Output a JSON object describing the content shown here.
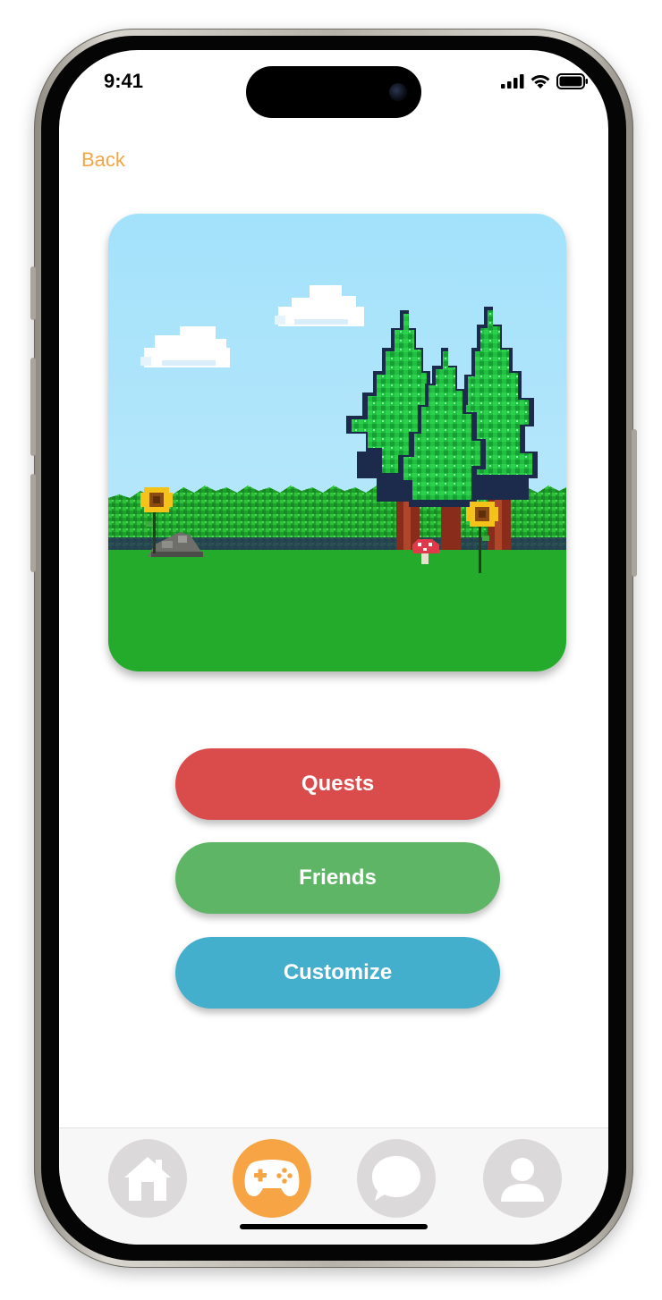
{
  "status_bar": {
    "time": "9:41"
  },
  "nav": {
    "back_label": "Back"
  },
  "scene": {
    "alt": "Pixel-art forest scene with trees, sunflowers, clouds, rock and mushroom"
  },
  "menu": {
    "buttons": [
      {
        "label": "Quests",
        "color": "#da4c4c"
      },
      {
        "label": "Friends",
        "color": "#5db565"
      },
      {
        "label": "Customize",
        "color": "#44aecd"
      }
    ]
  },
  "tab_bar": {
    "tabs": [
      {
        "icon": "home-icon",
        "active": false
      },
      {
        "icon": "gamepad-icon",
        "active": true
      },
      {
        "icon": "chat-icon",
        "active": false
      },
      {
        "icon": "profile-icon",
        "active": false
      }
    ]
  },
  "colors": {
    "accent": "#f7a544",
    "tab_inactive": "#dcd9da",
    "tab_icon_inactive": "#ffffff",
    "sky": "#a3e2fb",
    "grass": "#25ab2b"
  }
}
